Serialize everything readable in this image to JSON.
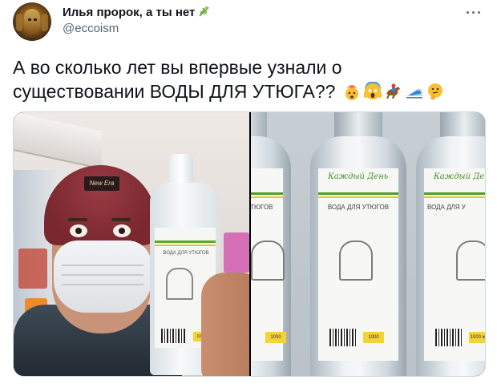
{
  "author": {
    "display_name": "Илья пророк, а ты нет",
    "handle": "@eccoism",
    "verified_badge": "herb-icon"
  },
  "tweet": {
    "text_line1": "А во сколько лет вы впервые узнали о",
    "text_line2": "существовании ВОДЫ ДЛЯ УТЮГА??",
    "emoji": [
      "exploding-head-icon",
      "screaming-face-icon",
      "horse-racing-icon",
      "bullet-train-icon",
      "thinking-face-icon"
    ]
  },
  "media": {
    "left_photo": {
      "hat_text": "New Era",
      "bottle_label": "ВОДА ДЛЯ УТЮГОВ",
      "bottle_volume": "1000"
    },
    "right_photo": {
      "brand": "Каждый День",
      "label": "ВОДА ДЛЯ УТЮГОВ",
      "label_partial_left": "УТЮГОВ",
      "label_partial_right": "ВОДА ДЛЯ У",
      "volume": "1000 мл",
      "volume_short": "1000"
    }
  },
  "colors": {
    "text_primary": "#0f1419",
    "text_secondary": "#536471",
    "label_green": "#4f9d2d",
    "label_yellow": "#f3d23a"
  }
}
